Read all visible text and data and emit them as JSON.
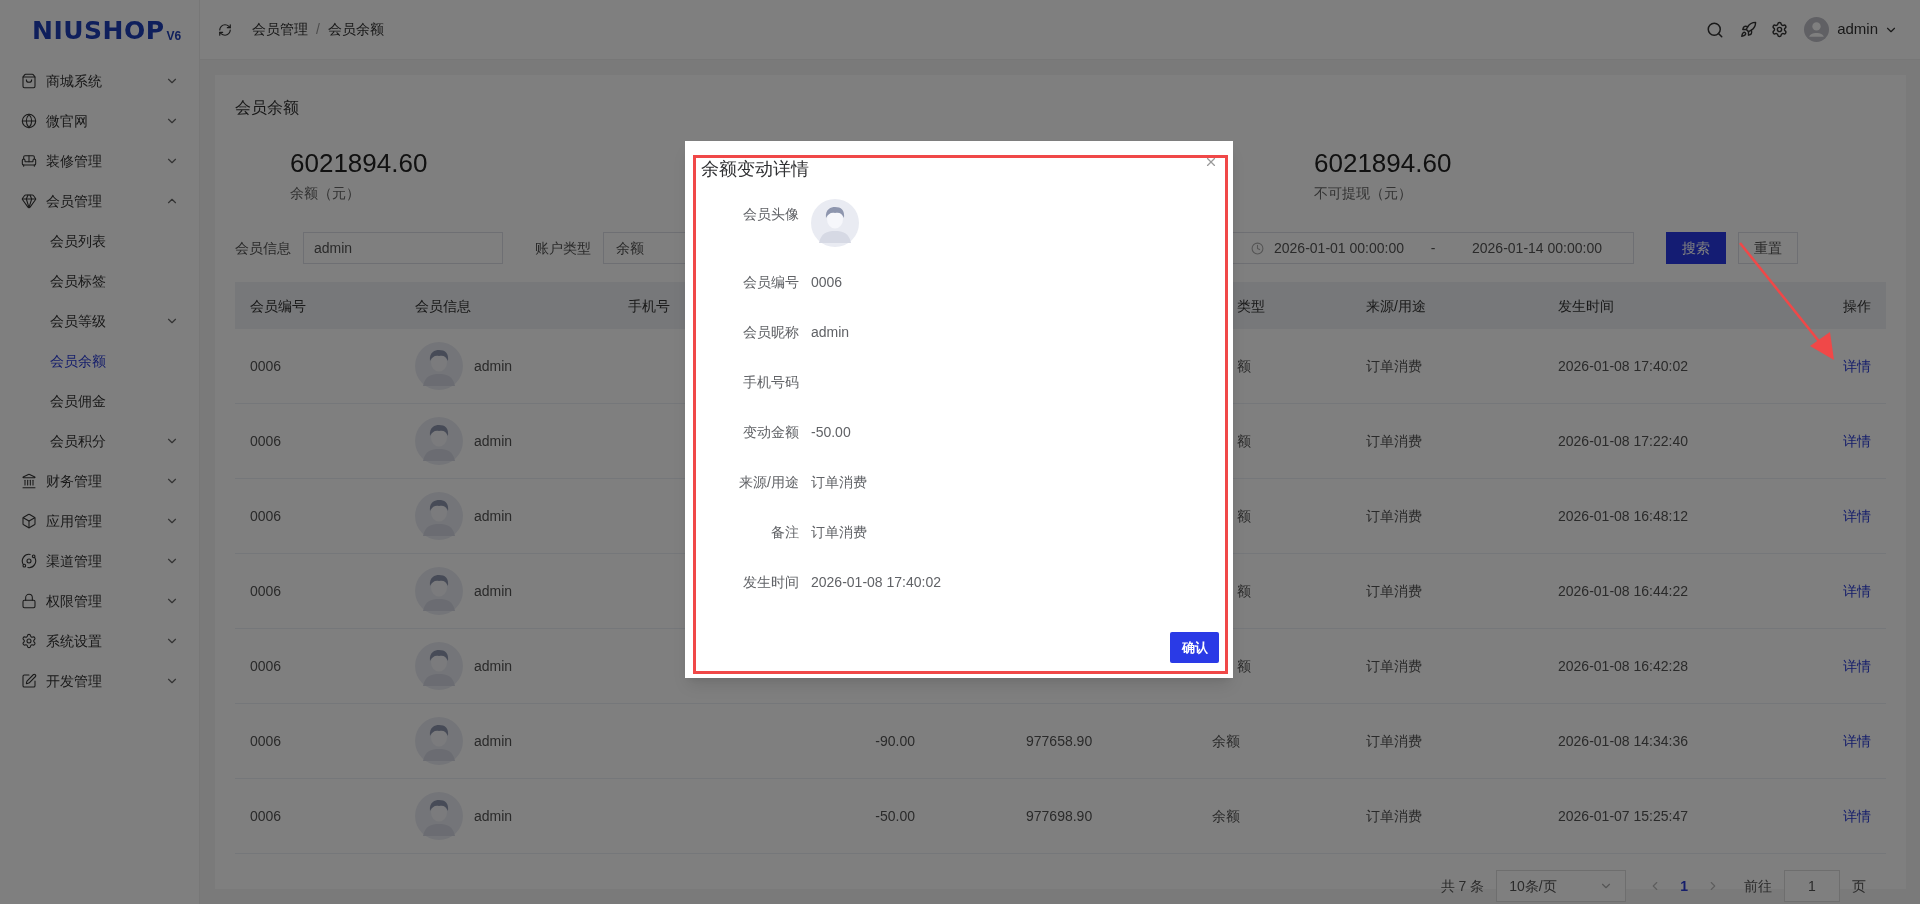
{
  "logo": {
    "name": "NIUSHOP",
    "version": "V6"
  },
  "sidebar": {
    "items": [
      {
        "label": "商城系统",
        "expanded": false
      },
      {
        "label": "微官网",
        "expanded": false
      },
      {
        "label": "装修管理",
        "expanded": false
      },
      {
        "label": "会员管理",
        "expanded": true,
        "children": [
          {
            "label": "会员列表",
            "selected": false,
            "collapsible": false
          },
          {
            "label": "会员标签",
            "selected": false,
            "collapsible": false
          },
          {
            "label": "会员等级",
            "selected": false,
            "collapsible": true
          },
          {
            "label": "会员余额",
            "selected": true,
            "collapsible": false
          },
          {
            "label": "会员佣金",
            "selected": false,
            "collapsible": false
          },
          {
            "label": "会员积分",
            "selected": false,
            "collapsible": true
          }
        ]
      },
      {
        "label": "财务管理",
        "expanded": false
      },
      {
        "label": "应用管理",
        "expanded": false
      },
      {
        "label": "渠道管理",
        "expanded": false
      },
      {
        "label": "权限管理",
        "expanded": false
      },
      {
        "label": "系统设置",
        "expanded": false
      },
      {
        "label": "开发管理",
        "expanded": false
      }
    ]
  },
  "header": {
    "breadcrumb": [
      "会员管理",
      "会员余额"
    ],
    "separator": "/",
    "user": "admin"
  },
  "page_title": "会员余额",
  "stats": [
    {
      "value": "6021894.60",
      "label": "余额（元）"
    },
    {
      "value": "6021894.60",
      "label": "不可提现（元）"
    }
  ],
  "filters": {
    "member_info": {
      "label": "会员信息",
      "value": "admin"
    },
    "account_type": {
      "label": "账户类型",
      "value": "余额"
    },
    "date_range": {
      "start": "2026-01-01 00:00:00",
      "separator": "-",
      "end": "2026-01-14 00:00:00"
    },
    "search": "搜索",
    "reset": "重置"
  },
  "table": {
    "columns": [
      {
        "label": "会员编号",
        "partly_covered": false
      },
      {
        "label": "会员信息",
        "partly_covered": false
      },
      {
        "label": "手机号",
        "partly_covered": false
      },
      {
        "label": "类型",
        "partly_covered": true
      },
      {
        "label": "来源/用途",
        "partly_covered": false
      },
      {
        "label": "发生时间",
        "partly_covered": false
      },
      {
        "label": "操作",
        "partly_covered": false
      }
    ],
    "rows": [
      {
        "member_no": "0006",
        "member_name": "admin",
        "account_type": "额",
        "account_type_partly_covered": true,
        "source": "订单消费",
        "time": "2026-01-08 17:40:02",
        "action": "详情"
      },
      {
        "member_no": "0006",
        "member_name": "admin",
        "account_type": "额",
        "account_type_partly_covered": true,
        "source": "订单消费",
        "time": "2026-01-08 17:22:40",
        "action": "详情"
      },
      {
        "member_no": "0006",
        "member_name": "admin",
        "account_type": "额",
        "account_type_partly_covered": true,
        "source": "订单消费",
        "time": "2026-01-08 16:48:12",
        "action": "详情"
      },
      {
        "member_no": "0006",
        "member_name": "admin",
        "account_type": "额",
        "account_type_partly_covered": true,
        "source": "订单消费",
        "time": "2026-01-08 16:44:22",
        "action": "详情"
      },
      {
        "member_no": "0006",
        "member_name": "admin",
        "account_type": "额",
        "account_type_partly_covered": true,
        "source": "订单消费",
        "time": "2026-01-08 16:42:28",
        "action": "详情"
      },
      {
        "member_no": "0006",
        "member_name": "admin",
        "amount": "-90.00",
        "balance": "977658.90",
        "account_type": "余额",
        "account_type_partly_covered": false,
        "source": "订单消费",
        "time": "2026-01-08 14:34:36",
        "action": "详情"
      },
      {
        "member_no": "0006",
        "member_name": "admin",
        "amount": "-50.00",
        "balance": "977698.90",
        "account_type": "余额",
        "account_type_partly_covered": false,
        "source": "订单消费",
        "time": "2026-01-07 15:25:47",
        "action": "详情"
      }
    ]
  },
  "pagination": {
    "total": "共 7 条",
    "page_size": "10条/页",
    "pages": [
      {
        "label": "1",
        "selected": true
      }
    ],
    "goto_label": "前往",
    "goto_value": "1",
    "goto_suffix": "页"
  },
  "dialog": {
    "title": "余额变动详情",
    "fields": [
      {
        "kind": "avatar",
        "label": "会员头像"
      },
      {
        "kind": "text",
        "label": "会员编号",
        "value": "0006"
      },
      {
        "kind": "text",
        "label": "会员昵称",
        "value": "admin"
      },
      {
        "kind": "text",
        "label": "手机号码"
      },
      {
        "kind": "text",
        "label": "变动金额",
        "value": "-50.00"
      },
      {
        "kind": "text",
        "label": "来源/用途",
        "value": "订单消费"
      },
      {
        "kind": "text",
        "label": "备注",
        "value": "订单消费"
      },
      {
        "kind": "text",
        "label": "发生时间",
        "value": "2026-01-08 17:40:02"
      }
    ],
    "confirm": "确认"
  },
  "annotations": {
    "highlight_frame": true,
    "arrow": true
  }
}
